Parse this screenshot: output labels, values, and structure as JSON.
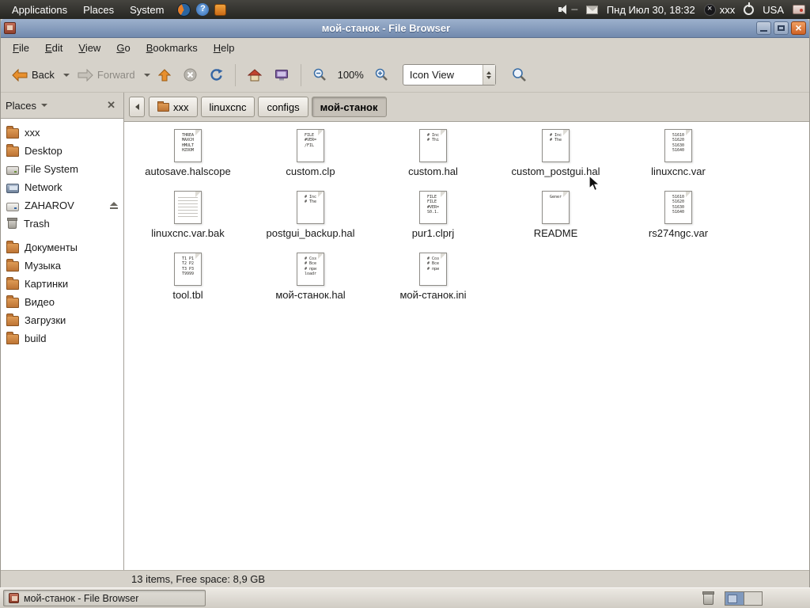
{
  "colors": {
    "titlebar": "#7189ad",
    "titlebar_light": "#9db1cd",
    "panel_bg": "#2e2e2a",
    "window_bg": "#d6d2ca",
    "selection_blue": "#8099bd",
    "accent_orange": "#e8902e"
  },
  "top_panel": {
    "menus": [
      {
        "label": "Applications"
      },
      {
        "label": "Places"
      },
      {
        "label": "System"
      }
    ],
    "clock": "Пнд Июл 30, 18:32",
    "user_label": "xxx",
    "keyboard_layout": "USA"
  },
  "window": {
    "title": "мой-станок - File Browser",
    "menubar": [
      {
        "label": "File"
      },
      {
        "label": "Edit"
      },
      {
        "label": "View"
      },
      {
        "label": "Go"
      },
      {
        "label": "Bookmarks"
      },
      {
        "label": "Help"
      }
    ],
    "toolbar": {
      "back": "Back",
      "forward": "Forward",
      "zoom": "100%",
      "view_mode": "Icon View"
    },
    "pathbar": [
      {
        "label": "xxx",
        "icon": "folder",
        "active": false
      },
      {
        "label": "linuxcnc",
        "active": false
      },
      {
        "label": "configs",
        "active": false
      },
      {
        "label": "мой-станок",
        "active": true
      }
    ],
    "sidebar": {
      "title": "Places",
      "items": [
        {
          "label": "xxx",
          "icon": "folder"
        },
        {
          "label": "Desktop",
          "icon": "folder"
        },
        {
          "label": "File System",
          "icon": "drive"
        },
        {
          "label": "Network",
          "icon": "network"
        },
        {
          "label": "ZAHAROV",
          "icon": "disk",
          "eject": true
        },
        {
          "label": "Trash",
          "icon": "trash"
        },
        {
          "label": "Документы",
          "icon": "folder",
          "gap": true
        },
        {
          "label": "Музыка",
          "icon": "folder"
        },
        {
          "label": "Картинки",
          "icon": "folder"
        },
        {
          "label": "Видео",
          "icon": "folder"
        },
        {
          "label": "Загрузки",
          "icon": "folder"
        },
        {
          "label": "build",
          "icon": "folder"
        }
      ]
    },
    "files": [
      {
        "name": "autosave.halscope",
        "preview": "THREA\nMAXCH\nHMULT\nHZOOM",
        "kind": "code"
      },
      {
        "name": "custom.clp",
        "preview": "FILE\n#VER=\n/FIL",
        "kind": "code"
      },
      {
        "name": "custom.hal",
        "preview": "# Inc\n# Thi",
        "kind": "code"
      },
      {
        "name": "custom_postgui.hal",
        "preview": "# Inc\n# The",
        "kind": "code"
      },
      {
        "name": "linuxcnc.var",
        "preview": "51610\n51620\n51630\n51640",
        "kind": "code"
      },
      {
        "name": "linuxcnc.var.bak",
        "preview": "",
        "kind": "plain"
      },
      {
        "name": "postgui_backup.hal",
        "preview": "# Inc\n# The",
        "kind": "code"
      },
      {
        "name": "pur1.clprj",
        "preview": "FILE\nFILE\n#VER=\nS0.1.",
        "kind": "code"
      },
      {
        "name": "README",
        "preview": "Gener",
        "kind": "code"
      },
      {
        "name": "rs274ngc.var",
        "preview": "51610\n51620\n51630\n51640",
        "kind": "code"
      },
      {
        "name": "tool.tbl",
        "preview": "T1 P1\nT2 P2\nT3 P3\nT9999",
        "kind": "code"
      },
      {
        "name": "мой-станок.hal",
        "preview": "# Соз\n# Все\n# при\nloadr",
        "kind": "code"
      },
      {
        "name": "мой-станок.ini",
        "preview": "# Соз\n# Все\n# при",
        "kind": "code"
      }
    ],
    "statusbar": "13 items, Free space: 8,9 GB"
  },
  "taskbar": {
    "window_button": "мой-станок - File Browser"
  }
}
